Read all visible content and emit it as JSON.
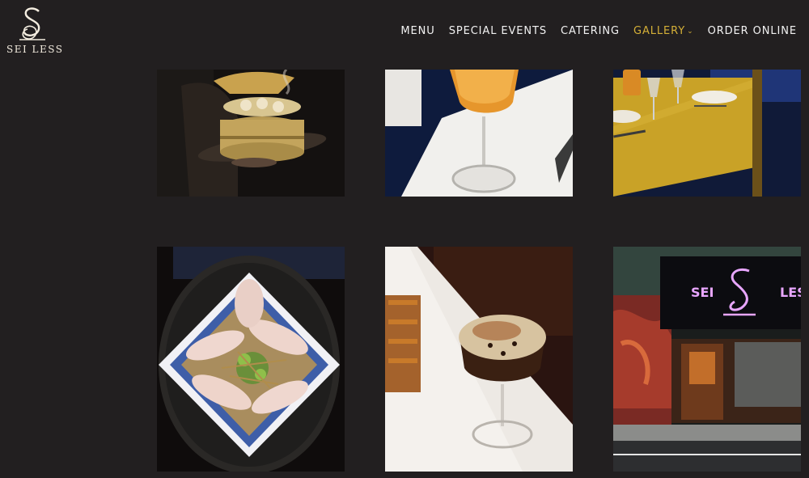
{
  "brand": {
    "name": "SEI LESS"
  },
  "nav": {
    "items": [
      {
        "label": "MENU"
      },
      {
        "label": "SPECIAL EVENTS"
      },
      {
        "label": "CATERING"
      },
      {
        "label": "GALLERY"
      },
      {
        "label": "ORDER ONLINE"
      }
    ],
    "active_index": 3,
    "active_color": "#d4af37"
  },
  "gallery": {
    "images": [
      {
        "name": "dim-sum-steamer-photo"
      },
      {
        "name": "orange-cocktail-photo"
      },
      {
        "name": "dining-table-photo"
      },
      {
        "name": "dumpling-plate-photo"
      },
      {
        "name": "espresso-martini-photo"
      },
      {
        "name": "storefront-neon-sign-photo",
        "sign_text": "SEI LESS"
      }
    ]
  },
  "colors": {
    "background": "#221f20",
    "neon": "#e8a6ff"
  }
}
